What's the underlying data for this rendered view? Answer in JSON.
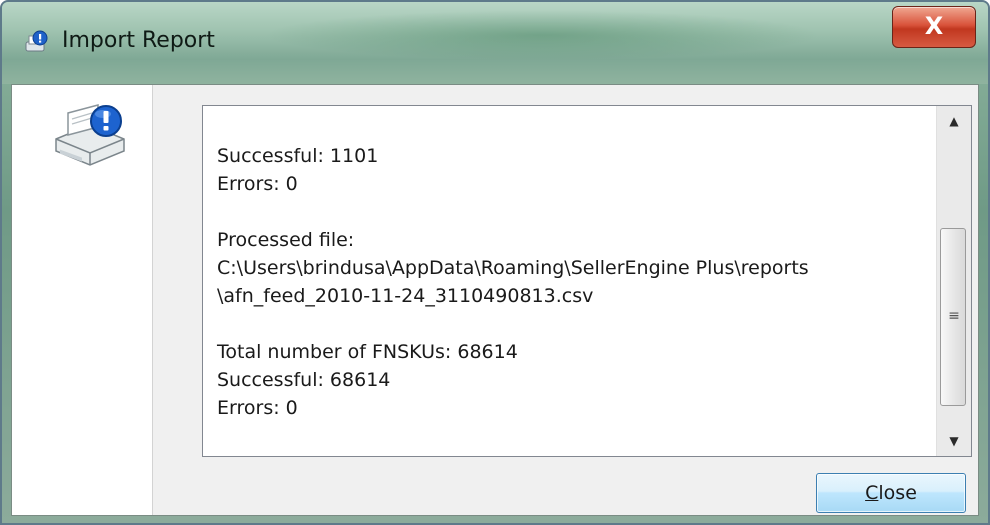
{
  "window": {
    "title": "Import Report",
    "title_icon": "info-printer-icon",
    "close_glyph": "X"
  },
  "dialog": {
    "icon": "printer-info-icon",
    "report_lines": [
      "Successful: 1101",
      "Errors: 0",
      "",
      "Processed file:",
      "C:\\Users\\brindusa\\AppData\\Roaming\\SellerEngine Plus\\reports",
      "\\afn_feed_2010-11-24_3110490813.csv",
      "",
      "Total number of FNSKUs: 68614",
      "Successful: 68614",
      "Errors: 0"
    ],
    "close_button": {
      "access_key": "C",
      "rest": "lose"
    }
  },
  "colors": {
    "accent": "#3c7fb1",
    "close_red": "#c1371f"
  }
}
